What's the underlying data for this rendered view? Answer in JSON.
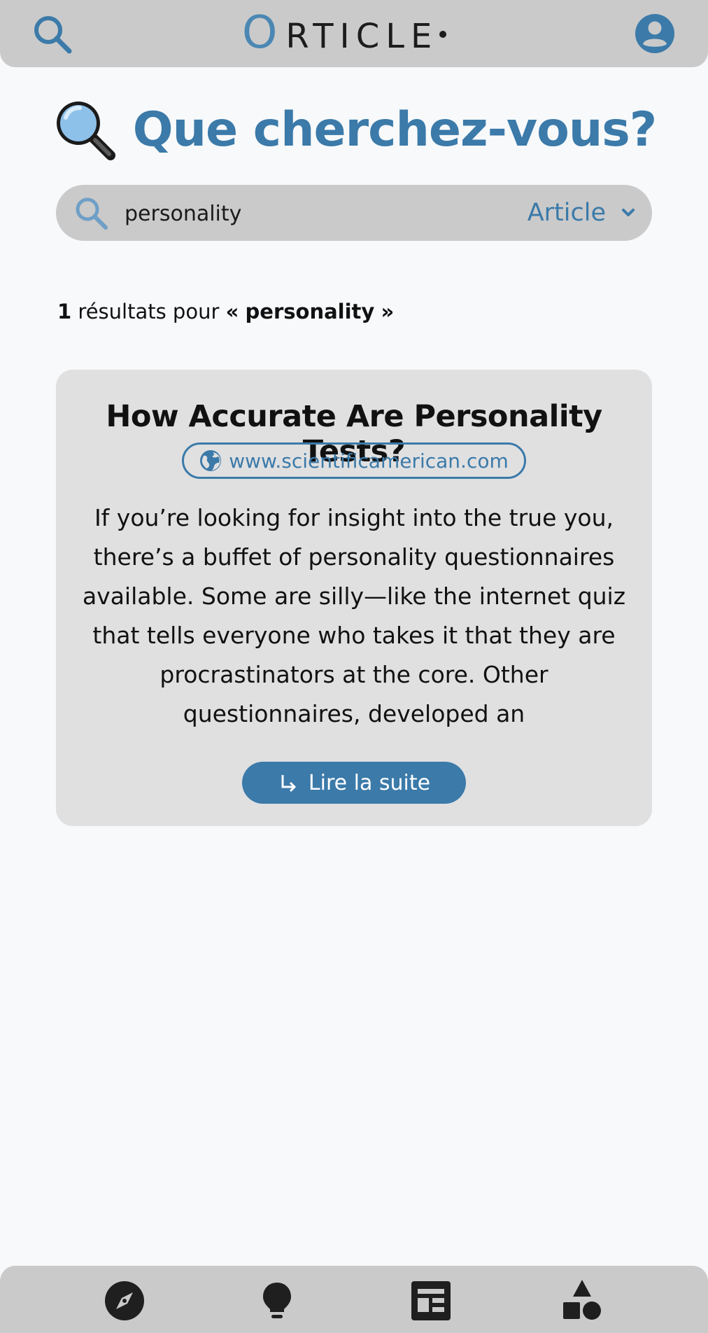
{
  "header": {
    "logo_initial": "O",
    "logo_rest": "RTICLE"
  },
  "heading": {
    "title": "Que cherchez-vous?",
    "emoji_icon": "magnifying-glass-emoji"
  },
  "search": {
    "value": "personality",
    "type_selected": "Article"
  },
  "results": {
    "count": "1",
    "text": "résultats pour",
    "open_quote": "«",
    "query": "personality",
    "close_quote": "»"
  },
  "article": {
    "title": "How Accurate Are Personality Tests?",
    "source": "www.scientificamerican.com",
    "excerpt": "If you’re looking for insight into the true you, there’s a buffet of personality questionnaires available. Some are silly—like the internet quiz that tells everyone who takes it that they are procrastinators at the core. Other questionnaires, developed an",
    "read_more": "Lire la suite"
  },
  "bottom_nav": {
    "items": [
      "compass-icon",
      "lightbulb-icon",
      "article-icon",
      "shapes-icon"
    ]
  },
  "colors": {
    "accent": "#3b7aa9",
    "bar_bg": "#cacaca",
    "card_bg": "#e0e0e1",
    "page_bg": "#f7f9fb"
  }
}
